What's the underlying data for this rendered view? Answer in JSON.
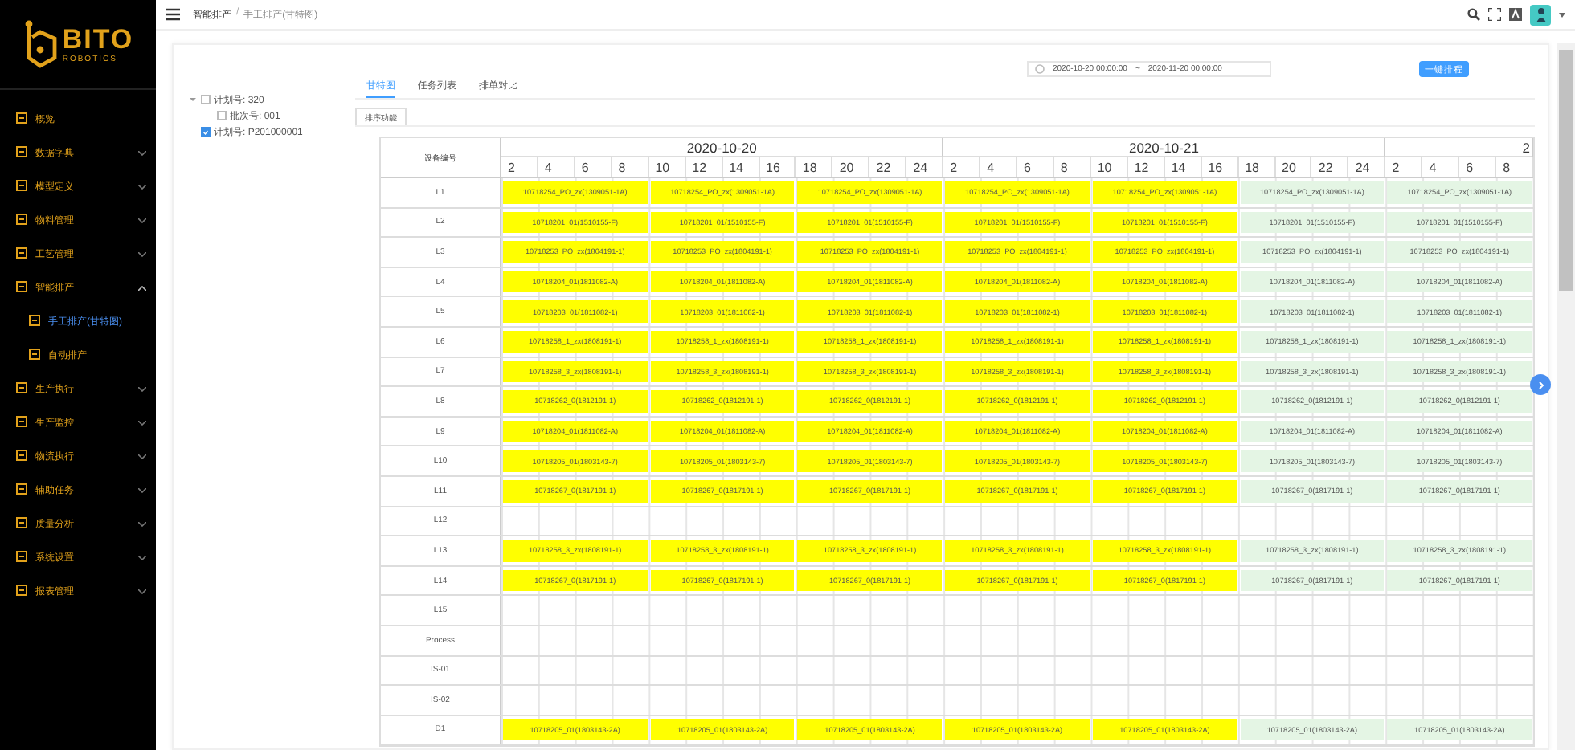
{
  "sidebar": {
    "logo": "BITO",
    "logo_sub": "ROBOTICS",
    "items": [
      {
        "label": "概览",
        "kind": "link"
      },
      {
        "label": "数据字典",
        "kind": "group",
        "expanded": false
      },
      {
        "label": "模型定义",
        "kind": "group",
        "expanded": false
      },
      {
        "label": "物料管理",
        "kind": "group",
        "expanded": false
      },
      {
        "label": "工艺管理",
        "kind": "group",
        "expanded": false
      },
      {
        "label": "智能排产",
        "kind": "group",
        "expanded": true,
        "children": [
          {
            "label": "手工排产(甘特图)",
            "selected": true
          },
          {
            "label": "自动排产",
            "selected": false
          }
        ]
      },
      {
        "label": "生产执行",
        "kind": "group",
        "expanded": false
      },
      {
        "label": "生产监控",
        "kind": "group",
        "expanded": false
      },
      {
        "label": "物流执行",
        "kind": "group",
        "expanded": false
      },
      {
        "label": "辅助任务",
        "kind": "group",
        "expanded": false
      },
      {
        "label": "质量分析",
        "kind": "group",
        "expanded": false
      },
      {
        "label": "系统设置",
        "kind": "group",
        "expanded": false
      },
      {
        "label": "报表管理",
        "kind": "group",
        "expanded": false
      }
    ]
  },
  "breadcrumb": [
    "智能排产",
    "手工排产(甘特图)"
  ],
  "breadcrumb_separator": "/",
  "tree": [
    {
      "label": "计划号: 320",
      "checked": false,
      "expanded": true,
      "children": [
        {
          "label": "批次号: 001",
          "checked": false
        }
      ]
    },
    {
      "label": "计划号: P201000001",
      "checked": true
    }
  ],
  "date_range": {
    "start": "2020-10-20 00:00:00",
    "separator": "~",
    "end": "2020-11-20 00:00:00"
  },
  "schedule_button": "一键排程",
  "tabs": [
    {
      "label": "甘特图",
      "selected": true
    },
    {
      "label": "任务列表",
      "selected": false
    },
    {
      "label": "排单对比",
      "selected": false
    }
  ],
  "sort_button": "排序功能",
  "gantt": {
    "row_header": "设备编号",
    "days": [
      {
        "label": "2020-10-20",
        "hours": [
          "2",
          "4",
          "6",
          "8",
          "10",
          "12",
          "14",
          "16",
          "18",
          "20",
          "22",
          "24"
        ]
      },
      {
        "label": "2020-10-21",
        "hours": [
          "2",
          "4",
          "6",
          "8",
          "10",
          "12",
          "14",
          "16",
          "18",
          "20",
          "22",
          "24"
        ]
      },
      {
        "label": "2",
        "hours": [
          "2",
          "4",
          "6",
          "8"
        ]
      }
    ],
    "rows": [
      {
        "label": "L1",
        "bars": [
          {
            "text": "10718254_PO_zx(1309051-1A)",
            "color": "#ffff00"
          },
          {
            "text": "10718254_PO_zx(1309051-1A)",
            "color": "#ffff00"
          },
          {
            "text": "10718254_PO_zx(1309051-1A)",
            "color": "#ffff00"
          },
          {
            "text": "10718254_PO_zx(1309051-1A)",
            "color": "#ffff00"
          },
          {
            "text": "10718254_PO_zx(1309051-1A)",
            "color": "#ffff00"
          },
          {
            "text": "10718254_PO_zx(1309051-1A)",
            "color": "#e4f5e4"
          },
          {
            "text": "10718254_PO_zx(1309051-1A)",
            "color": "#e4f5e4"
          }
        ]
      },
      {
        "label": "L2",
        "bars": [
          {
            "text": "10718201_01(1510155-F)",
            "color": "#ffff00"
          },
          {
            "text": "10718201_01(1510155-F)",
            "color": "#ffff00"
          },
          {
            "text": "10718201_01(1510155-F)",
            "color": "#ffff00"
          },
          {
            "text": "10718201_01(1510155-F)",
            "color": "#ffff00"
          },
          {
            "text": "10718201_01(1510155-F)",
            "color": "#ffff00"
          },
          {
            "text": "10718201_01(1510155-F)",
            "color": "#e4f5e4"
          },
          {
            "text": "10718201_01(1510155-F)",
            "color": "#e4f5e4"
          }
        ]
      },
      {
        "label": "L3",
        "bars": [
          {
            "text": "10718253_PO_zx(1804191-1)",
            "color": "#ffff00"
          },
          {
            "text": "10718253_PO_zx(1804191-1)",
            "color": "#ffff00"
          },
          {
            "text": "10718253_PO_zx(1804191-1)",
            "color": "#ffff00"
          },
          {
            "text": "10718253_PO_zx(1804191-1)",
            "color": "#ffff00"
          },
          {
            "text": "10718253_PO_zx(1804191-1)",
            "color": "#ffff00"
          },
          {
            "text": "10718253_PO_zx(1804191-1)",
            "color": "#e4f5e4"
          },
          {
            "text": "10718253_PO_zx(1804191-1)",
            "color": "#e4f5e4"
          }
        ]
      },
      {
        "label": "L4",
        "bars": [
          {
            "text": "10718204_01(1811082-A)",
            "color": "#ffff00"
          },
          {
            "text": "10718204_01(1811082-A)",
            "color": "#ffff00"
          },
          {
            "text": "10718204_01(1811082-A)",
            "color": "#ffff00"
          },
          {
            "text": "10718204_01(1811082-A)",
            "color": "#ffff00"
          },
          {
            "text": "10718204_01(1811082-A)",
            "color": "#ffff00"
          },
          {
            "text": "10718204_01(1811082-A)",
            "color": "#e4f5e4"
          },
          {
            "text": "10718204_01(1811082-A)",
            "color": "#e4f5e4"
          }
        ]
      },
      {
        "label": "L5",
        "bars": [
          {
            "text": "10718203_01(1811082-1)",
            "color": "#ffff00"
          },
          {
            "text": "10718203_01(1811082-1)",
            "color": "#ffff00"
          },
          {
            "text": "10718203_01(1811082-1)",
            "color": "#ffff00"
          },
          {
            "text": "10718203_01(1811082-1)",
            "color": "#ffff00"
          },
          {
            "text": "10718203_01(1811082-1)",
            "color": "#ffff00"
          },
          {
            "text": "10718203_01(1811082-1)",
            "color": "#e4f5e4"
          },
          {
            "text": "10718203_01(1811082-1)",
            "color": "#e4f5e4"
          }
        ]
      },
      {
        "label": "L6",
        "bars": [
          {
            "text": "10718258_1_zx(1808191-1)",
            "color": "#ffff00"
          },
          {
            "text": "10718258_1_zx(1808191-1)",
            "color": "#ffff00"
          },
          {
            "text": "10718258_1_zx(1808191-1)",
            "color": "#ffff00"
          },
          {
            "text": "10718258_1_zx(1808191-1)",
            "color": "#ffff00"
          },
          {
            "text": "10718258_1_zx(1808191-1)",
            "color": "#ffff00"
          },
          {
            "text": "10718258_1_zx(1808191-1)",
            "color": "#e4f5e4"
          },
          {
            "text": "10718258_1_zx(1808191-1)",
            "color": "#e4f5e4"
          }
        ]
      },
      {
        "label": "L7",
        "bars": [
          {
            "text": "10718258_3_zx(1808191-1)",
            "color": "#ffff00"
          },
          {
            "text": "10718258_3_zx(1808191-1)",
            "color": "#ffff00"
          },
          {
            "text": "10718258_3_zx(1808191-1)",
            "color": "#ffff00"
          },
          {
            "text": "10718258_3_zx(1808191-1)",
            "color": "#ffff00"
          },
          {
            "text": "10718258_3_zx(1808191-1)",
            "color": "#ffff00"
          },
          {
            "text": "10718258_3_zx(1808191-1)",
            "color": "#e4f5e4"
          },
          {
            "text": "10718258_3_zx(1808191-1)",
            "color": "#e4f5e4"
          }
        ]
      },
      {
        "label": "L8",
        "bars": [
          {
            "text": "10718262_0(1812191-1)",
            "color": "#ffff00"
          },
          {
            "text": "10718262_0(1812191-1)",
            "color": "#ffff00"
          },
          {
            "text": "10718262_0(1812191-1)",
            "color": "#ffff00"
          },
          {
            "text": "10718262_0(1812191-1)",
            "color": "#ffff00"
          },
          {
            "text": "10718262_0(1812191-1)",
            "color": "#ffff00"
          },
          {
            "text": "10718262_0(1812191-1)",
            "color": "#e4f5e4"
          },
          {
            "text": "10718262_0(1812191-1)",
            "color": "#e4f5e4"
          }
        ]
      },
      {
        "label": "L9",
        "bars": [
          {
            "text": "10718204_01(1811082-A)",
            "color": "#ffff00"
          },
          {
            "text": "10718204_01(1811082-A)",
            "color": "#ffff00"
          },
          {
            "text": "10718204_01(1811082-A)",
            "color": "#ffff00"
          },
          {
            "text": "10718204_01(1811082-A)",
            "color": "#ffff00"
          },
          {
            "text": "10718204_01(1811082-A)",
            "color": "#ffff00"
          },
          {
            "text": "10718204_01(1811082-A)",
            "color": "#e4f5e4"
          },
          {
            "text": "10718204_01(1811082-A)",
            "color": "#e4f5e4"
          }
        ]
      },
      {
        "label": "L10",
        "bars": [
          {
            "text": "10718205_01(1803143-7)",
            "color": "#ffff00"
          },
          {
            "text": "10718205_01(1803143-7)",
            "color": "#ffff00"
          },
          {
            "text": "10718205_01(1803143-7)",
            "color": "#ffff00"
          },
          {
            "text": "10718205_01(1803143-7)",
            "color": "#ffff00"
          },
          {
            "text": "10718205_01(1803143-7)",
            "color": "#ffff00"
          },
          {
            "text": "10718205_01(1803143-7)",
            "color": "#e4f5e4"
          },
          {
            "text": "10718205_01(1803143-7)",
            "color": "#e4f5e4"
          }
        ]
      },
      {
        "label": "L11",
        "bars": [
          {
            "text": "10718267_0(1817191-1)",
            "color": "#ffff00"
          },
          {
            "text": "10718267_0(1817191-1)",
            "color": "#ffff00"
          },
          {
            "text": "10718267_0(1817191-1)",
            "color": "#ffff00"
          },
          {
            "text": "10718267_0(1817191-1)",
            "color": "#ffff00"
          },
          {
            "text": "10718267_0(1817191-1)",
            "color": "#ffff00"
          },
          {
            "text": "10718267_0(1817191-1)",
            "color": "#e4f5e4"
          },
          {
            "text": "10718267_0(1817191-1)",
            "color": "#e4f5e4"
          }
        ]
      },
      {
        "label": "L12",
        "bars": []
      },
      {
        "label": "L13",
        "bars": [
          {
            "text": "10718258_3_zx(1808191-1)",
            "color": "#ffff00"
          },
          {
            "text": "10718258_3_zx(1808191-1)",
            "color": "#ffff00"
          },
          {
            "text": "10718258_3_zx(1808191-1)",
            "color": "#ffff00"
          },
          {
            "text": "10718258_3_zx(1808191-1)",
            "color": "#ffff00"
          },
          {
            "text": "10718258_3_zx(1808191-1)",
            "color": "#ffff00"
          },
          {
            "text": "10718258_3_zx(1808191-1)",
            "color": "#e4f5e4"
          },
          {
            "text": "10718258_3_zx(1808191-1)",
            "color": "#e4f5e4"
          }
        ]
      },
      {
        "label": "L14",
        "bars": [
          {
            "text": "10718267_0(1817191-1)",
            "color": "#ffff00"
          },
          {
            "text": "10718267_0(1817191-1)",
            "color": "#ffff00"
          },
          {
            "text": "10718267_0(1817191-1)",
            "color": "#ffff00"
          },
          {
            "text": "10718267_0(1817191-1)",
            "color": "#ffff00"
          },
          {
            "text": "10718267_0(1817191-1)",
            "color": "#ffff00"
          },
          {
            "text": "10718267_0(1817191-1)",
            "color": "#e4f5e4"
          },
          {
            "text": "10718267_0(1817191-1)",
            "color": "#e4f5e4"
          }
        ]
      },
      {
        "label": "L15",
        "bars": []
      },
      {
        "label": "Process",
        "bars": []
      },
      {
        "label": "IS-01",
        "bars": []
      },
      {
        "label": "IS-02",
        "bars": []
      },
      {
        "label": "D1",
        "bars": [
          {
            "text": "10718205_01(1803143-2A)",
            "color": "#ffff00"
          },
          {
            "text": "10718205_01(1803143-2A)",
            "color": "#ffff00"
          },
          {
            "text": "10718205_01(1803143-2A)",
            "color": "#ffff00"
          },
          {
            "text": "10718205_01(1803143-2A)",
            "color": "#ffff00"
          },
          {
            "text": "10718205_01(1803143-2A)",
            "color": "#ffff00"
          },
          {
            "text": "10718205_01(1803143-2A)",
            "color": "#e4f5e4"
          },
          {
            "text": "10718205_01(1803143-2A)",
            "color": "#e4f5e4"
          }
        ]
      }
    ]
  }
}
